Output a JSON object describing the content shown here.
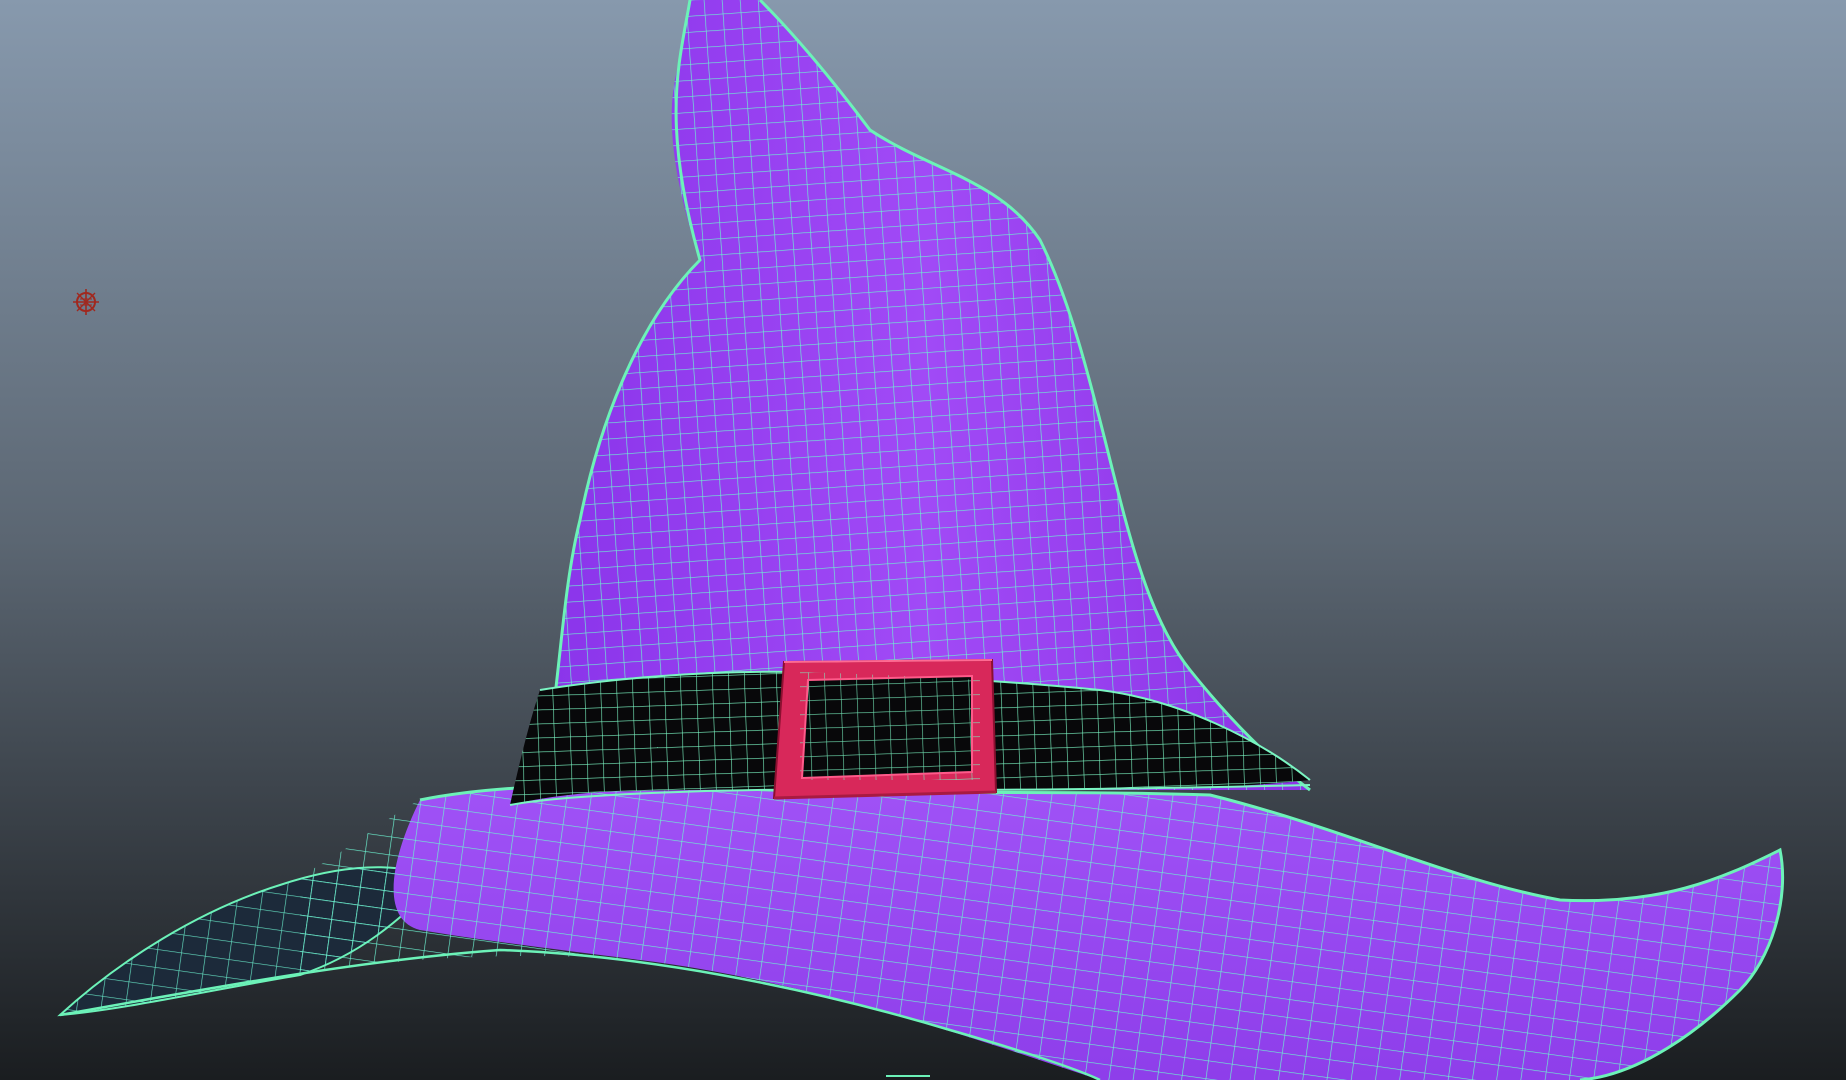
{
  "viewport": {
    "background_top": "#8799ad",
    "background_bottom": "#1a1d20",
    "wireframe_color": "#6cf2b8",
    "wireframe_selected_color": "#5ff596"
  },
  "hat": {
    "name_icon": "witch-hat-mesh",
    "body_color": "#9a3df2",
    "body_shade_color": "#7a28d6",
    "band_color": "#08080a",
    "buckle_color": "#d8285a",
    "buckle_highlight": "#ff5a8a"
  },
  "light": {
    "icon": "point-light-icon",
    "color": "#a0281e"
  }
}
